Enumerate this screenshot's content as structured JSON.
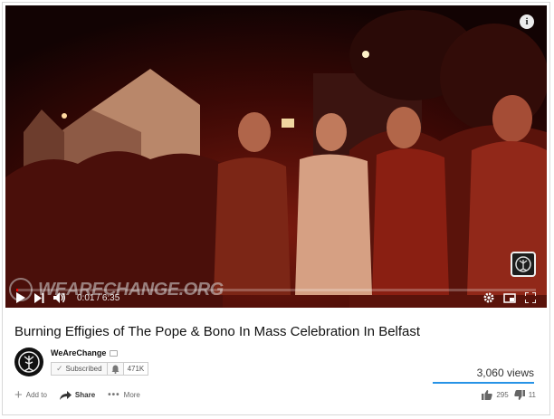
{
  "player": {
    "watermark_text": "WEARECHANGE.ORG",
    "time_current": "0:01",
    "time_separator": "/",
    "time_total": "6:35",
    "progress_fraction": 0.003,
    "accent_color": "#ff0000"
  },
  "video": {
    "title": "Burning Effigies of The Pope & Bono In Mass Celebration In Belfast",
    "views": "3,060 views"
  },
  "channel": {
    "name": "WeAreChange",
    "subscribe_label": "Subscribed",
    "subscriber_count": "471K"
  },
  "actions": {
    "add_label": "Add to",
    "share_label": "Share",
    "more_label": "More",
    "likes": "295",
    "dislikes": "11",
    "like_ratio": 0.964
  },
  "icons": [
    "info-icon",
    "play-icon",
    "next-icon",
    "volume-icon",
    "settings-icon",
    "miniplayer-icon",
    "fullscreen-icon",
    "bell-icon",
    "plus-icon",
    "share-icon",
    "thumbs-up-icon",
    "thumbs-down-icon"
  ]
}
